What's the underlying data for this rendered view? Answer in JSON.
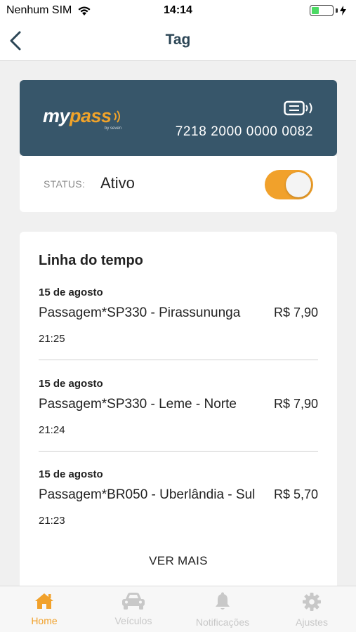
{
  "status_bar": {
    "carrier": "Nenhum SIM",
    "time": "14:14"
  },
  "nav": {
    "title": "Tag",
    "back_icon": "chevron-left-icon"
  },
  "card": {
    "brand_my": "my",
    "brand_pass": "pass",
    "brand_sub": "by seven",
    "number": "7218 2000 0000 0082",
    "background_color": "#37566a",
    "accent_color": "#f0a32a"
  },
  "status": {
    "label": "STATUS:",
    "value": "Ativo",
    "toggle_on": true
  },
  "timeline": {
    "title": "Linha do tempo",
    "items": [
      {
        "date": "15 de agosto",
        "description": "Passagem*SP330 - Pirassununga",
        "amount": "R$ 7,90",
        "time": "21:25"
      },
      {
        "date": "15 de agosto",
        "description": "Passagem*SP330 - Leme - Norte",
        "amount": "R$ 7,90",
        "time": "21:24"
      },
      {
        "date": "15 de agosto",
        "description": "Passagem*BR050 - Uberlândia - Sul",
        "amount": "R$ 5,70",
        "time": "21:23"
      }
    ],
    "more_label": "VER MAIS"
  },
  "tabs": [
    {
      "label": "Home",
      "icon": "home-icon",
      "active": true
    },
    {
      "label": "Veículos",
      "icon": "car-icon",
      "active": false
    },
    {
      "label": "Notificações",
      "icon": "bell-icon",
      "active": false
    },
    {
      "label": "Ajustes",
      "icon": "gear-icon",
      "active": false
    }
  ]
}
